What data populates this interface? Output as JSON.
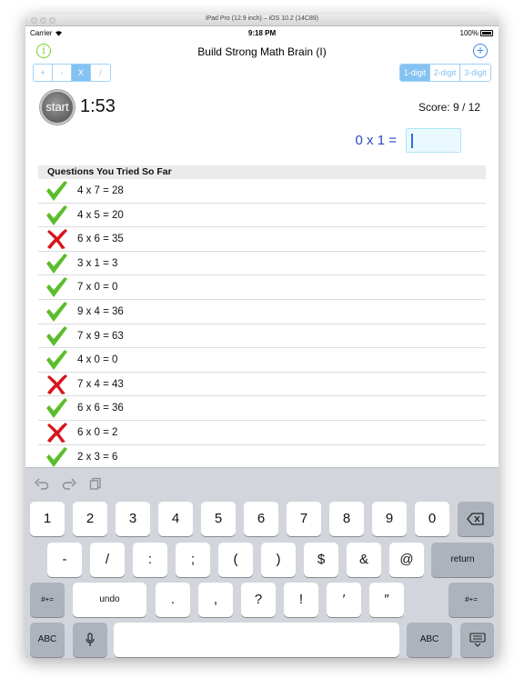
{
  "window": {
    "title": "iPad Pro (12.9 inch) – iOS 10.2 (14C89)"
  },
  "status_bar": {
    "carrier": "Carrier",
    "time": "9:18 PM",
    "battery": "100%"
  },
  "nav": {
    "title": "Build Strong Math Brain (I)",
    "info_glyph": "i",
    "add_glyph": "+"
  },
  "operations": [
    {
      "label": "+",
      "selected": false
    },
    {
      "label": "-",
      "selected": false
    },
    {
      "label": "X",
      "selected": true
    },
    {
      "label": "/",
      "selected": false
    }
  ],
  "digits": [
    {
      "label": "1-digit",
      "selected": true
    },
    {
      "label": "2-digit",
      "selected": false
    },
    {
      "label": "3-digit",
      "selected": false
    }
  ],
  "game": {
    "start_label": "start",
    "timer": "1:53",
    "score": "Score: 9 / 12",
    "question": "0 x 1 =",
    "answer_value": ""
  },
  "history": {
    "header": "Questions You Tried So Far",
    "items": [
      {
        "text": "4 x 7 = 28",
        "correct": true
      },
      {
        "text": "4 x 5 = 20",
        "correct": true
      },
      {
        "text": "6 x 6 = 35",
        "correct": false
      },
      {
        "text": "3 x 1 = 3",
        "correct": true
      },
      {
        "text": "7 x 0 = 0",
        "correct": true
      },
      {
        "text": "9 x 4 = 36",
        "correct": true
      },
      {
        "text": "7 x 9 = 63",
        "correct": true
      },
      {
        "text": "4 x 0 = 0",
        "correct": true
      },
      {
        "text": "7 x 4 = 43",
        "correct": false
      },
      {
        "text": "6 x 6 = 36",
        "correct": true
      },
      {
        "text": "6 x 0 = 2",
        "correct": false
      },
      {
        "text": "2 x 3 = 6",
        "correct": true
      }
    ]
  },
  "colors": {
    "check": "#5bbd2b",
    "cross": "#d8141c",
    "accent_blue": "#84c2f2",
    "question_blue": "#2747c7"
  },
  "keyboard": {
    "tools": [
      "undo-icon",
      "redo-icon",
      "paste-icon"
    ],
    "row1": [
      "1",
      "2",
      "3",
      "4",
      "5",
      "6",
      "7",
      "8",
      "9",
      "0"
    ],
    "row2": [
      "-",
      "/",
      ":",
      ";",
      "(",
      ")",
      "$",
      "&",
      "@"
    ],
    "row3": [
      ".",
      ",",
      "?",
      "!",
      "′",
      "″"
    ],
    "delete_icon": "backspace-icon",
    "return_label": "return",
    "symbols_label": "#+=",
    "undo_label": "undo",
    "abc_label": "ABC",
    "mic_icon": "microphone-icon",
    "hide_icon": "keyboard-hide-icon"
  }
}
